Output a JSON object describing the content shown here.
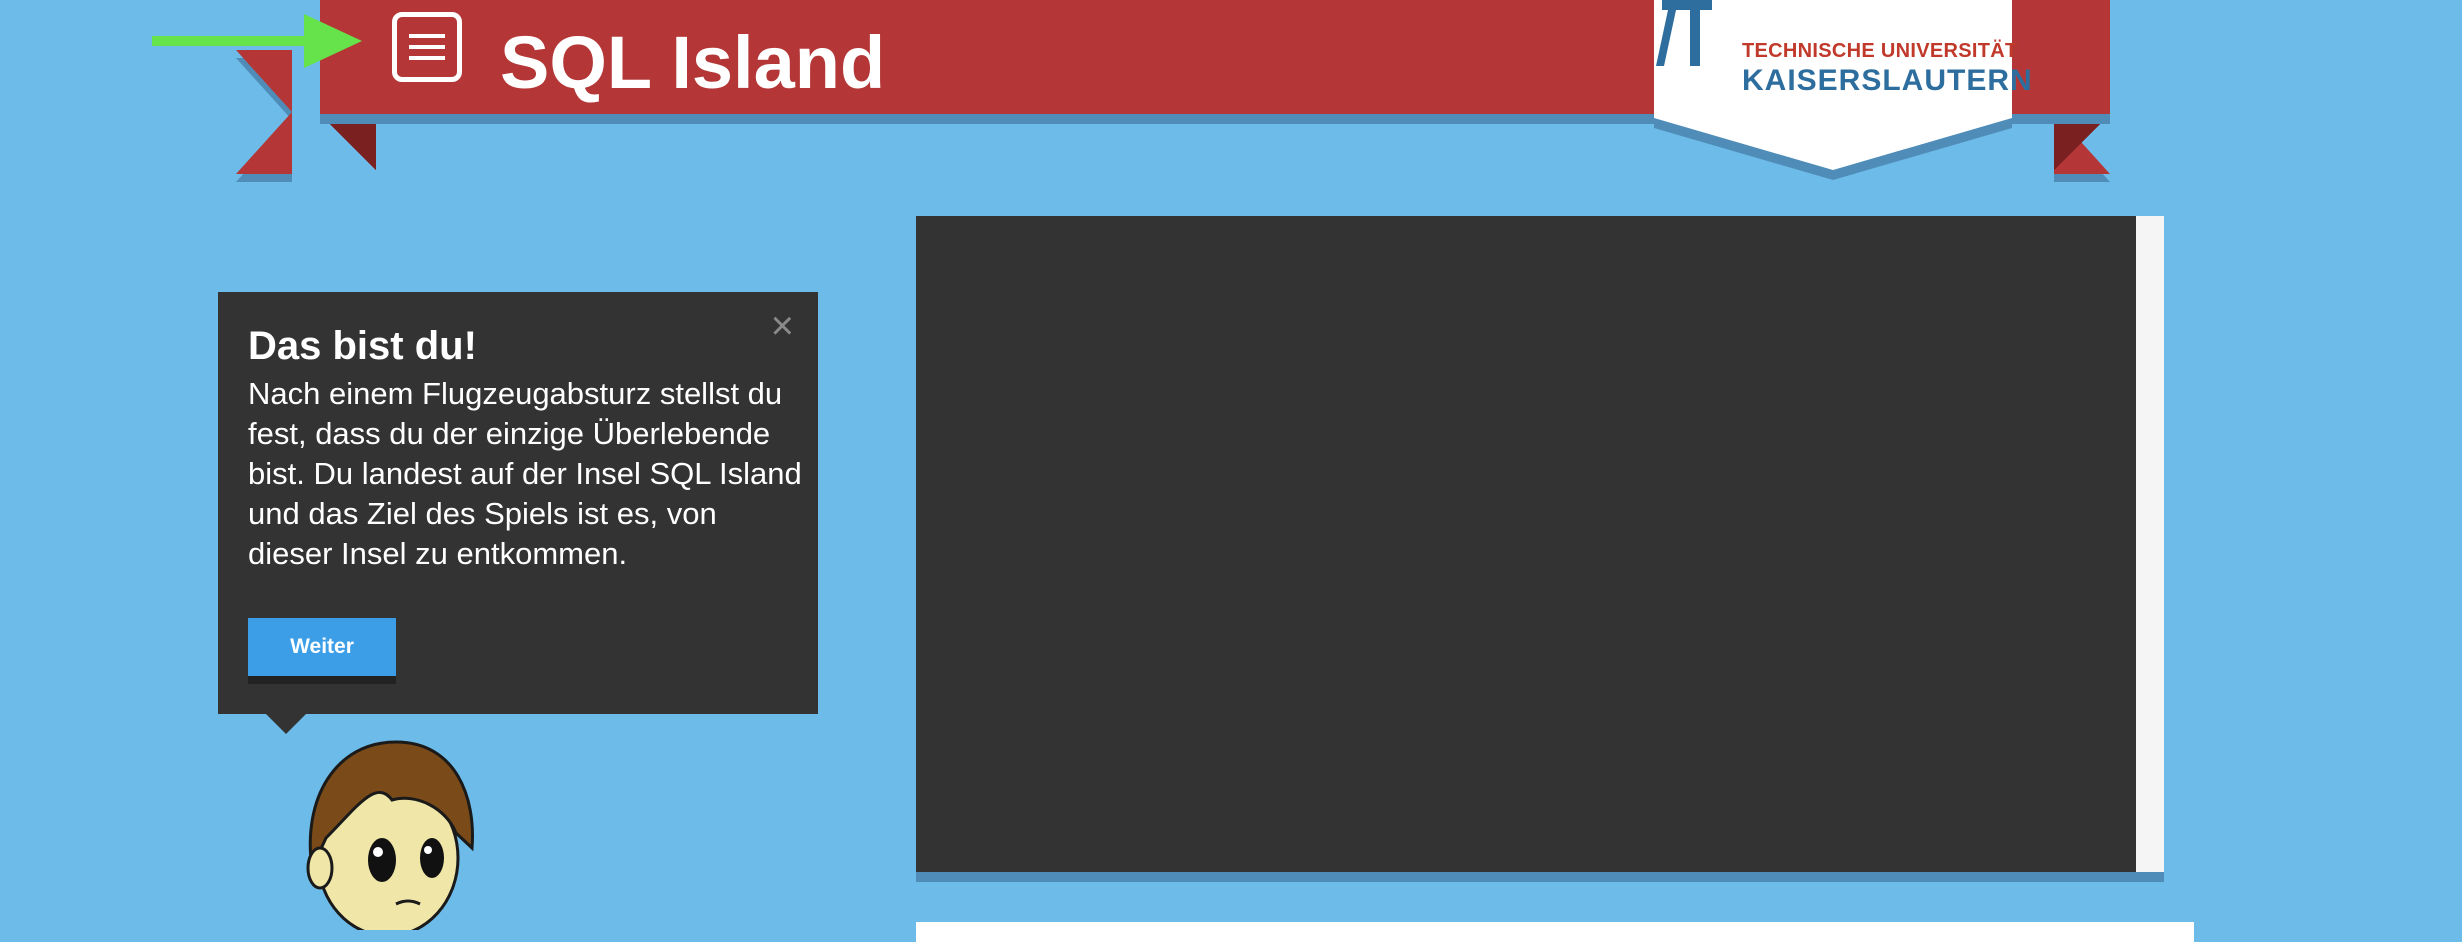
{
  "header": {
    "title": "SQL Island",
    "menu_icon": "menu-list-icon",
    "arrow_icon": "green-arrow-icon",
    "university": {
      "line1": "TECHNISCHE UNIVERSITÄT",
      "line2": "KAISERSLAUTERN",
      "logo_icon": "tu-kaiserslautern-logo-icon"
    }
  },
  "tooltip": {
    "title": "Das bist du!",
    "body": "Nach einem Flugzeugabsturz stellst du fest, dass du der einzige Überlebende bist. Du landest auf der Insel SQL Island und das Ziel des Spiels ist es, von dieser Insel zu entkommen.",
    "close_symbol": "×",
    "button_label": "Weiter"
  },
  "colors": {
    "background": "#6dbbe8",
    "banner": "#b43636",
    "panel": "#333333",
    "button": "#3d9ee8",
    "arrow": "#66e34a"
  }
}
